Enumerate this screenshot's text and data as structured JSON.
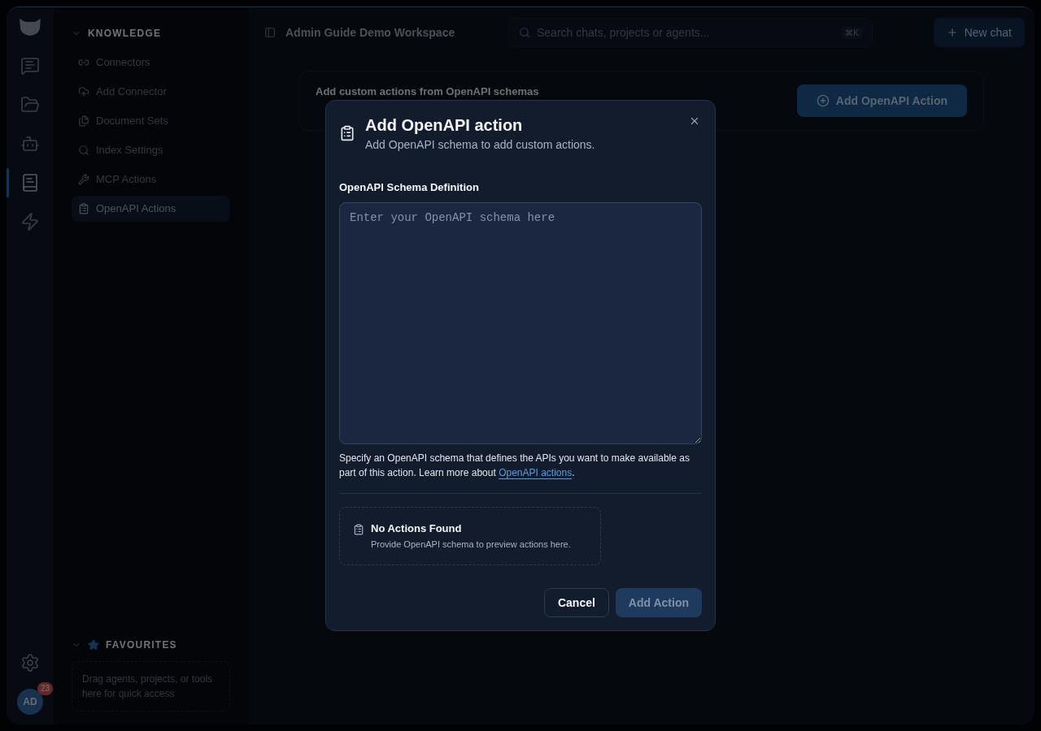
{
  "rail": {
    "items": [
      {
        "kind": "chat",
        "selected": false
      },
      {
        "kind": "folder",
        "selected": false
      },
      {
        "kind": "bot",
        "selected": false
      },
      {
        "kind": "book",
        "selected": true
      },
      {
        "kind": "bolt",
        "selected": false
      }
    ],
    "user": {
      "initials": "AD",
      "badge": "23"
    }
  },
  "sidebar": {
    "knowledge": {
      "title": "KNOWLEDGE",
      "expanded": true,
      "items": [
        {
          "label": "Connectors",
          "kind": "link",
          "selected": false
        },
        {
          "label": "Add Connector",
          "kind": "upload",
          "selected": false
        },
        {
          "label": "Document Sets",
          "kind": "docs",
          "selected": false
        },
        {
          "label": "Index Settings",
          "kind": "search",
          "selected": false
        },
        {
          "label": "MCP Actions",
          "kind": "tools",
          "selected": false
        },
        {
          "label": "OpenAPI Actions",
          "kind": "clipboard",
          "selected": true
        }
      ]
    },
    "favourites": {
      "title": "FAVOURITES",
      "expanded": true,
      "hint": "Drag agents, projects, or tools here for quick access"
    }
  },
  "header": {
    "title": "Admin Guide Demo Workspace",
    "search": {
      "placeholder": "Search chats, projects or agents...",
      "shortcut": "⌘K"
    },
    "new_chat": "New chat"
  },
  "content": {
    "description": "Add custom actions from OpenAPI schemas",
    "button": "Add OpenAPI Action"
  },
  "dialog": {
    "title": "Add OpenAPI action",
    "subtitle": "Add OpenAPI schema to add custom actions.",
    "field_label": "OpenAPI Schema Definition",
    "placeholder": "Enter your OpenAPI schema here",
    "help_before": "Specify an OpenAPI schema that defines the APIs you want to make available as part of this action. Learn more about ",
    "help_link": "OpenAPI actions",
    "help_after": ".",
    "empty_title": "No Actions Found",
    "empty_text": "Provide OpenAPI schema to preview actions here.",
    "cancel": "Cancel",
    "submit": {
      "label": "Add Action",
      "disabled": true
    }
  }
}
